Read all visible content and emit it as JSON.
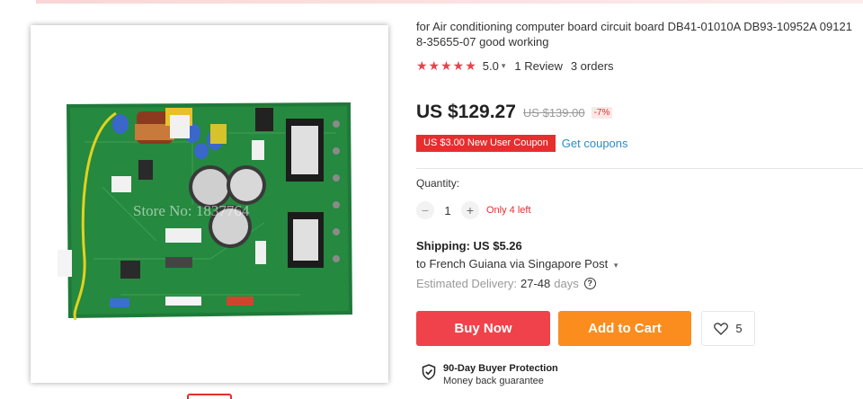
{
  "product": {
    "title": "for Air conditioning computer board circuit board DB41-01010A DB93-10952A 09121 8-35655-07 good working",
    "stars": "★★★★★",
    "rating": "5.0",
    "reviews": "1 Review",
    "orders": "3 orders",
    "image_watermark": "Store No: 1837764"
  },
  "pricing": {
    "price": "US $129.27",
    "old_price": "US $139.00",
    "discount": "-7%",
    "coupon": "US $3.00 New User Coupon",
    "get_coupons": "Get coupons"
  },
  "quantity": {
    "label": "Quantity:",
    "minus": "−",
    "value": "1",
    "plus": "+",
    "stock": "Only 4 left"
  },
  "shipping": {
    "title": "Shipping: US $5.26",
    "destination": "to French Guiana via Singapore Post",
    "delivery_label": "Estimated Delivery:",
    "delivery_days": "27-48",
    "delivery_unit": "days"
  },
  "actions": {
    "buy_now": "Buy Now",
    "add_to_cart": "Add to Cart",
    "wishlist_count": "5"
  },
  "protection": {
    "title": "90-Day Buyer Protection",
    "subtitle": "Money back guarantee"
  },
  "colors": {
    "accent_red": "#f0424a",
    "cart_orange": "#fa8d1e",
    "link_blue": "#2e8bc7",
    "star_red": "#e8424c"
  }
}
